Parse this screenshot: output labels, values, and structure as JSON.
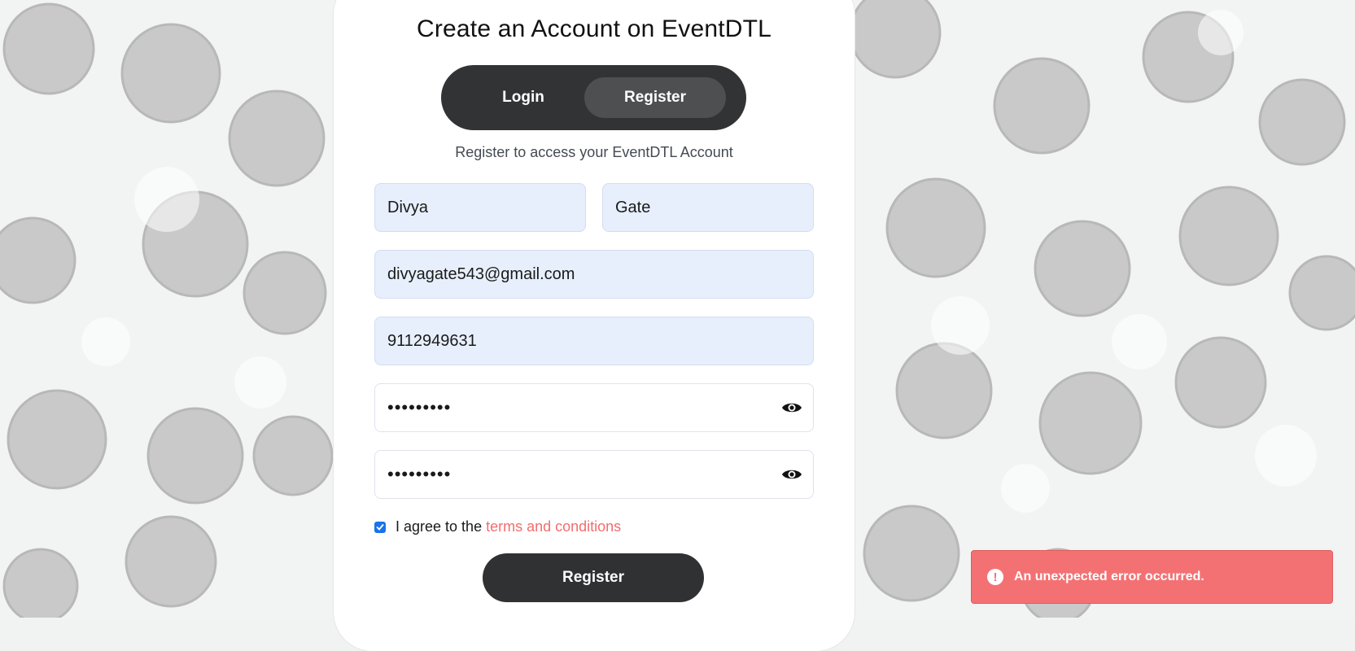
{
  "page": {
    "title": "Create an Account on EventDTL",
    "subtitle": "Register to access your EventDTL Account"
  },
  "tabs": [
    {
      "label": "Login",
      "active": false
    },
    {
      "label": "Register",
      "active": true
    }
  ],
  "form": {
    "first_name": "Divya",
    "last_name": "Gate",
    "email": "divyagate543@gmail.com",
    "phone": "9112949631",
    "password_masked": "•••••••••",
    "confirm_password_masked": "•••••••••",
    "terms_checked": true,
    "terms_prefix": "I agree to the",
    "terms_link": "terms and conditions",
    "submit_label": "Register"
  },
  "toast": {
    "icon": "error-icon",
    "message": "An unexpected error occurred."
  },
  "icons": {
    "eye": "eye-icon",
    "check": "checkmark-icon"
  },
  "colors": {
    "accent_dark": "#323335",
    "active_tab": "#4d4f51",
    "filled_input": "#e7effc",
    "link": "#f26d6d",
    "error_toast": "#f47173",
    "checkbox": "#1a73e8"
  }
}
